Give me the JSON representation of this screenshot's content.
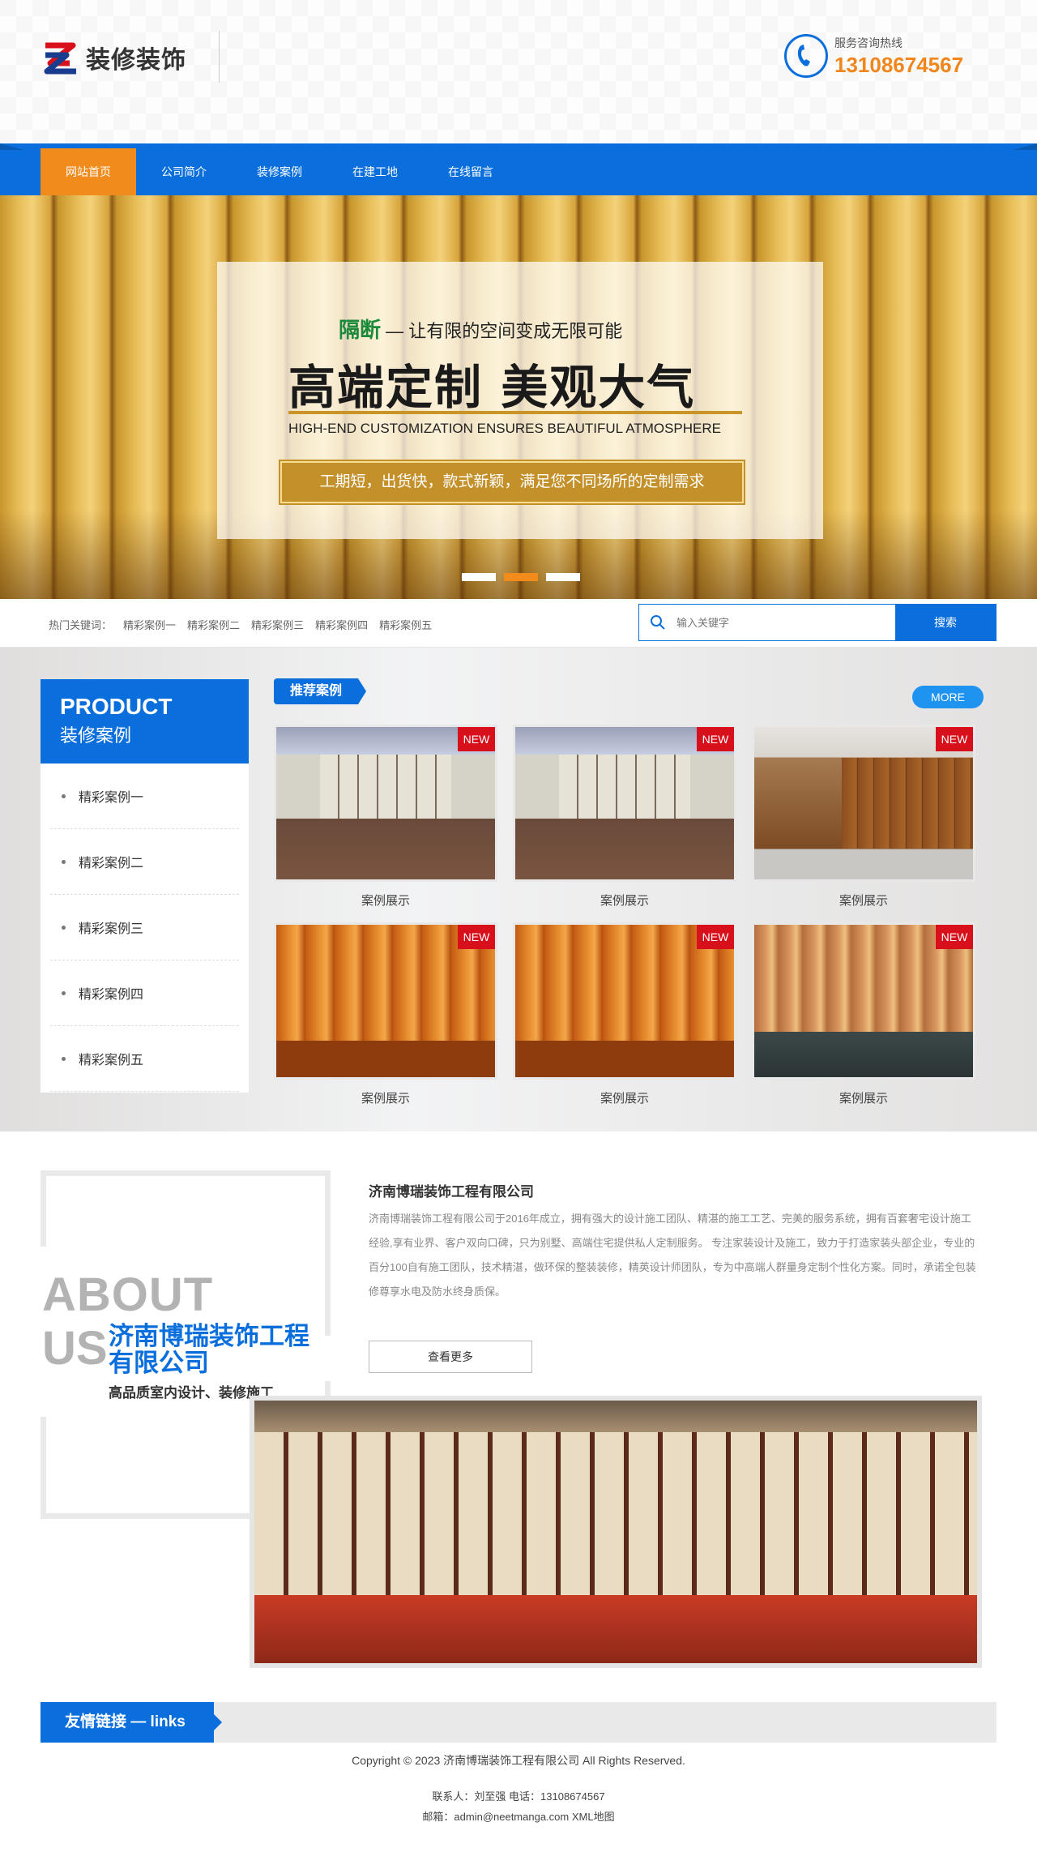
{
  "brand": {
    "name": "装修装饰",
    "colors": {
      "primary": "#0a6fdc",
      "accent": "#f08b1c",
      "badge": "#d8101b",
      "phone": "#f0861c"
    }
  },
  "hotline": {
    "label": "服务咨询热线",
    "number": "13108674567",
    "icon": "phone-icon"
  },
  "nav": {
    "items": [
      {
        "label": "网站首页",
        "active": true
      },
      {
        "label": "公司简介"
      },
      {
        "label": "装修案例"
      },
      {
        "label": "在建工地"
      },
      {
        "label": "在线留言"
      }
    ]
  },
  "banner": {
    "highlight": "隔断",
    "subtitle": "— 让有限的空间变成无限可能",
    "title": "高端定制  美观大气",
    "english": "HIGH-END CUSTOMIZATION ENSURES BEAUTIFUL ATMOSPHERE",
    "cta": "工期短，出货快，款式新颖，满足您不同场所的定制需求",
    "slides": 3,
    "active_slide": 2
  },
  "search": {
    "hot_label": "热门关键词：",
    "keywords": [
      "精彩案例一",
      "精彩案例二",
      "精彩案例三",
      "精彩案例四",
      "精彩案例五"
    ],
    "placeholder": "输入关键字",
    "button": "搜索"
  },
  "product": {
    "title_en": "PRODUCT",
    "title_cn": "装修案例",
    "side_items": [
      "精彩案例一",
      "精彩案例二",
      "精彩案例三",
      "精彩案例四",
      "精彩案例五"
    ],
    "section_label": "推荐案例",
    "more": "MORE",
    "badge": "NEW",
    "cards": [
      {
        "caption": "案例展示"
      },
      {
        "caption": "案例展示"
      },
      {
        "caption": "案例展示"
      },
      {
        "caption": "案例展示"
      },
      {
        "caption": "案例展示"
      },
      {
        "caption": "案例展示"
      }
    ]
  },
  "about": {
    "en1": "ABOUT",
    "en2": "US",
    "company_big": "济南博瑞装饰工程有限公司",
    "tagline": "高品质室内设计、装修施工",
    "title": "济南博瑞装饰工程有限公司",
    "body": "济南博瑞装饰工程有限公司于2016年成立，拥有强大的设计施工团队、精湛的施工工艺、完美的服务系统，拥有百套奢宅设计施工经验,享有业界、客户双向口碑，只为别墅、高端住宅提供私人定制服务。 专注家装设计及施工，致力于打造家装头部企业，专业的百分100自有施工团队，技术精湛，做环保的整装装修，精英设计师团队，专为中高端人群量身定制个性化方案。同时，承诺全包装修尊享水电及防水终身质保。",
    "more": "查看更多"
  },
  "links": {
    "title": "友情链接 — links"
  },
  "footer": {
    "copyright": "Copyright © 2023 济南博瑞装饰工程有限公司 All Rights Reserved.",
    "contact": "联系人：刘至强 电话：13108674567",
    "email": "邮箱：admin@neetmanga.com XML地图"
  }
}
